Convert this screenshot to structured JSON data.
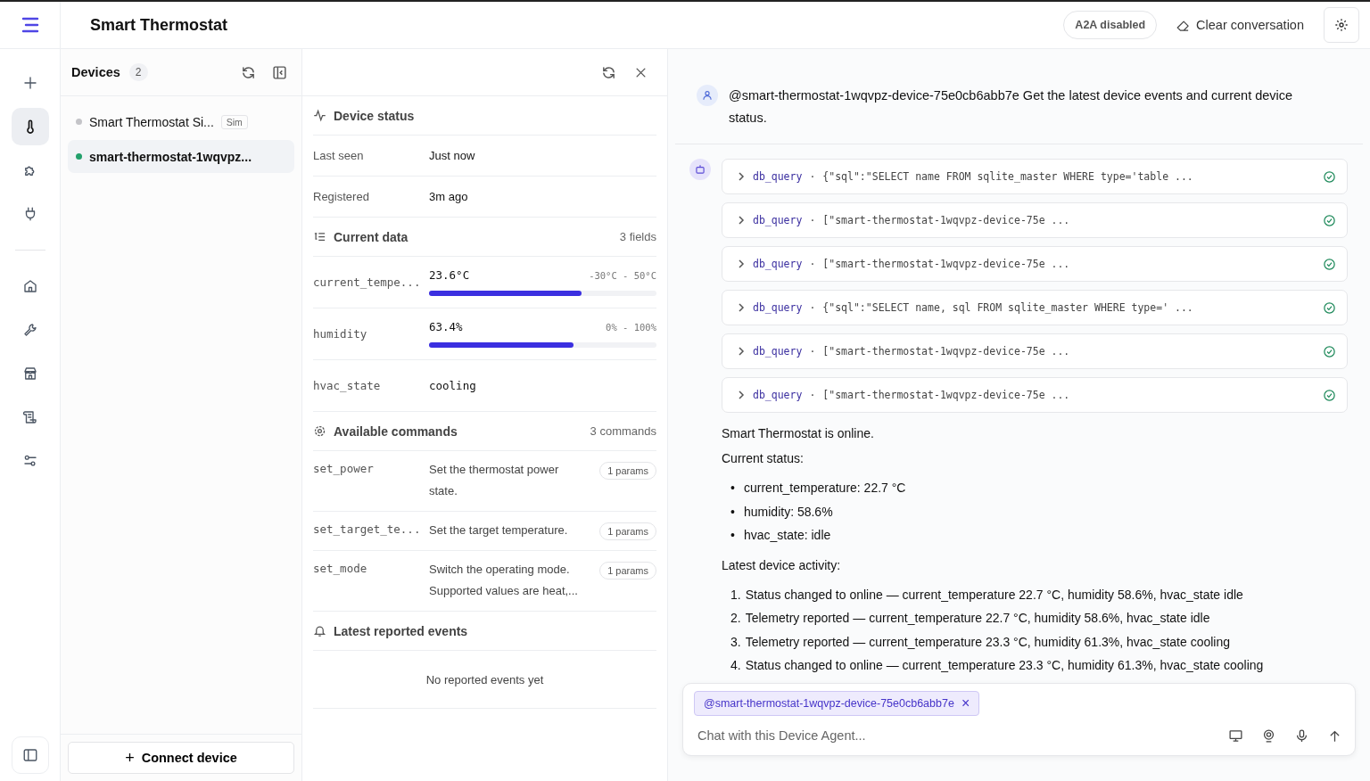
{
  "header": {
    "title": "Smart Thermostat",
    "a2a_badge": "A2A disabled",
    "clear_button": "Clear conversation"
  },
  "rail": {
    "devices": [
      {
        "kind": "new",
        "selected": false
      },
      {
        "kind": "thermometer",
        "selected": true
      },
      {
        "kind": "puzzle",
        "selected": false
      },
      {
        "kind": "plug",
        "selected": false
      }
    ],
    "tools": [
      {
        "kind": "home",
        "selected": false
      },
      {
        "kind": "wrench",
        "selected": false
      },
      {
        "kind": "store",
        "selected": false
      },
      {
        "kind": "scroll",
        "selected": false
      },
      {
        "kind": "sliders",
        "selected": false
      }
    ]
  },
  "devices": {
    "title": "Devices",
    "count": "2",
    "connect_icon": "+",
    "connect_button": "Connect device",
    "items": [
      {
        "name": "Smart Thermostat Si...",
        "badge": "Sim",
        "color": "#c4c4c8",
        "selected": false
      },
      {
        "name": "smart-thermostat-1wqvpz...",
        "color": "#22a06b",
        "selected": true
      }
    ]
  },
  "detail": {
    "status": {
      "title": "Device status",
      "rows": [
        {
          "label": "Last seen",
          "value": "Just now"
        },
        {
          "label": "Registered",
          "value": "3m ago"
        }
      ]
    },
    "current_data": {
      "title": "Current data",
      "count": "3 fields",
      "fields": [
        {
          "kind": "meter",
          "name": "current_tempe...",
          "value": "23.6°C",
          "range": "-30°C - 50°C",
          "level": 0.67
        },
        {
          "kind": "meter",
          "name": "humidity",
          "value": "63.4%",
          "range": "0% - 100%",
          "level": 0.634
        },
        {
          "kind": "text",
          "name": "hvac_state",
          "value": "cooling"
        }
      ]
    },
    "commands": {
      "title": "Available commands",
      "count": "3 commands",
      "items": [
        {
          "name": "set_power",
          "description": "Set the thermostat power state.",
          "params": "1 params"
        },
        {
          "name": "set_target_te...",
          "description": "Set the target temperature.",
          "params": "1 params"
        },
        {
          "name": "set_mode",
          "description": "Switch the operating mode. Supported values are heat,...",
          "params": "1 params"
        }
      ]
    },
    "events": {
      "title": "Latest reported events",
      "empty": "No reported events yet"
    }
  },
  "chat": {
    "user_message": "@smart-thermostat-1wqvpz-device-75e0cb6abb7e Get the latest device events and current device status.",
    "tool_calls": [
      {
        "name": "db_query",
        "separator": "·",
        "args": "{\"sql\":\"SELECT name FROM sqlite_master WHERE type='table ...",
        "done": true
      },
      {
        "name": "db_query",
        "separator": "·",
        "args": "[\"smart-thermostat-1wqvpz-device-75e ...",
        "done": true
      },
      {
        "name": "db_query",
        "separator": "·",
        "args": "[\"smart-thermostat-1wqvpz-device-75e ...",
        "done": true
      },
      {
        "name": "db_query",
        "separator": "·",
        "args": "{\"sql\":\"SELECT name, sql FROM sqlite_master WHERE type=' ...",
        "done": true
      },
      {
        "name": "db_query",
        "separator": "·",
        "args": "[\"smart-thermostat-1wqvpz-device-75e ...",
        "done": true
      },
      {
        "name": "db_query",
        "separator": "·",
        "args": "[\"smart-thermostat-1wqvpz-device-75e ...",
        "done": true
      }
    ],
    "reply": [
      {
        "kind": "paragraph",
        "text": "Smart Thermostat is online."
      },
      {
        "kind": "paragraph",
        "text": "Current status:"
      },
      {
        "kind": "list",
        "items": [
          {
            "marker": "•",
            "text": "current_temperature: 22.7 °C"
          },
          {
            "marker": "•",
            "text": "humidity: 58.6%"
          },
          {
            "marker": "•",
            "text": "hvac_state: idle"
          }
        ]
      },
      {
        "kind": "paragraph",
        "text": "Latest device activity:"
      },
      {
        "kind": "list",
        "items": [
          {
            "marker": "1.",
            "text": "Status changed to online — current_temperature 22.7 °C, humidity 58.6%, hvac_state idle"
          },
          {
            "marker": "2.",
            "text": "Telemetry reported — current_temperature 22.7 °C, humidity 58.6%, hvac_state idle"
          },
          {
            "marker": "3.",
            "text": "Telemetry reported — current_temperature 23.3 °C, humidity 61.3%, hvac_state cooling"
          },
          {
            "marker": "4.",
            "text": "Status changed to online — current_temperature 23.3 °C, humidity 61.3%, hvac_state cooling"
          }
        ]
      }
    ],
    "mention_chip": "@smart-thermostat-1wqvpz-device-75e0cb6abb7e",
    "chip_close": "×",
    "placeholder": "Chat with this Device Agent..."
  }
}
